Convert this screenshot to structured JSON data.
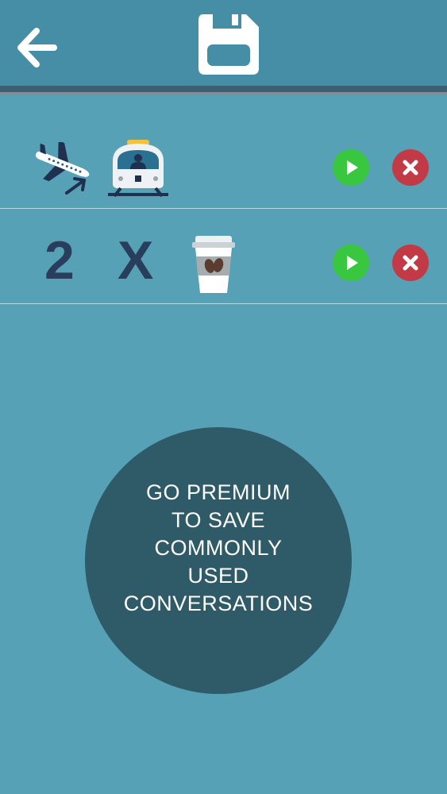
{
  "header": {
    "back_icon": "arrow-left-icon",
    "save_icon": "floppy-disk-icon"
  },
  "conversations": [
    {
      "icons": [
        "airplane-landing-icon",
        "train-icon"
      ],
      "play_icon": "play-icon",
      "delete_icon": "close-icon"
    },
    {
      "quantity": "2",
      "multiplier": "X",
      "icons": [
        "coffee-cup-icon"
      ],
      "play_icon": "play-icon",
      "delete_icon": "close-icon"
    }
  ],
  "premium": {
    "lines": [
      "GO PREMIUM",
      "TO SAVE",
      "COMMONLY",
      "USED",
      "CONVERSATIONS"
    ]
  },
  "colors": {
    "background": "#56a1b6",
    "header": "#468ea6",
    "play": "#39c740",
    "delete": "#c23a45",
    "premium_circle": "#2f5a68",
    "text_dark": "#283e5c"
  }
}
